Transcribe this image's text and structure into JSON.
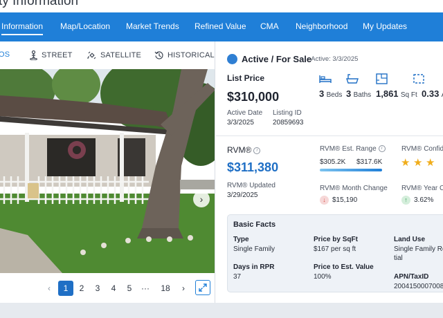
{
  "page": {
    "title": "ty Information"
  },
  "nav": [
    {
      "label": "Information",
      "active": true
    },
    {
      "label": "Map/Location"
    },
    {
      "label": "Market Trends"
    },
    {
      "label": "Refined Value"
    },
    {
      "label": "CMA"
    },
    {
      "label": "Neighborhood"
    },
    {
      "label": "My Updates"
    }
  ],
  "view_tabs": [
    {
      "label": "OS",
      "active": true
    },
    {
      "label": "STREET",
      "icon": "person-icon"
    },
    {
      "label": "SATELLITE",
      "icon": "satellite-icon"
    },
    {
      "label": "HISTORICAL",
      "icon": "history-icon"
    }
  ],
  "pagination": {
    "pages": [
      "1",
      "2",
      "3",
      "4",
      "5",
      "···",
      "18"
    ],
    "current": "1",
    "prev_icon": "chevron-left-icon",
    "next_icon": "chevron-right-icon"
  },
  "status": {
    "label": "Active / For Sale",
    "sub": "Active: 3/3/2025",
    "color": "#2f7fd3"
  },
  "listing": {
    "list_price_label": "List Price",
    "list_price": "$310,000",
    "active_date_label": "Active Date",
    "active_date": "3/3/2025",
    "listing_id_label": "Listing ID",
    "listing_id": "20859693"
  },
  "features": [
    {
      "value": "3",
      "unit": "Beds",
      "icon": "bed-icon"
    },
    {
      "value": "3",
      "unit": "Baths",
      "icon": "bathtub-icon"
    },
    {
      "value": "1,861",
      "unit": "Sq Ft",
      "icon": "floorplan-icon"
    },
    {
      "value": "0.33",
      "unit": "A",
      "icon": "lot-icon"
    }
  ],
  "rvm": {
    "label": "RVM®",
    "value": "$311,380",
    "updated_label": "RVM® Updated",
    "updated": "3/29/2025",
    "range_label": "RVM® Est. Range",
    "range_low": "$305.2K",
    "range_high": "$317.6K",
    "confidence_label": "RVM® Confide",
    "confidence_stars": 3,
    "month_change_label": "RVM® Month Change",
    "month_change": "$15,190",
    "year_change_label": "RVM® Year Ch",
    "year_change": "3.62%"
  },
  "basic_facts": {
    "title": "Basic Facts",
    "type_label": "Type",
    "type": "Single Family",
    "price_sqft_label": "Price by SqFt",
    "price_sqft": "$167 per sq ft",
    "land_use_label": "Land Use",
    "land_use_line1": "Single Family Re",
    "land_use_line2": "tial",
    "days_label": "Days in RPR",
    "days": "37",
    "price_est_label": "Price to Est. Value",
    "price_est": "100%",
    "apn_label": "APN/TaxID",
    "apn": "2004150007008"
  },
  "colors": {
    "nav_bg": "#1f7fd8",
    "accent": "#1f6fc5",
    "star": "#f0ad1b",
    "down": "#d9534f",
    "up": "#2f9e55"
  }
}
